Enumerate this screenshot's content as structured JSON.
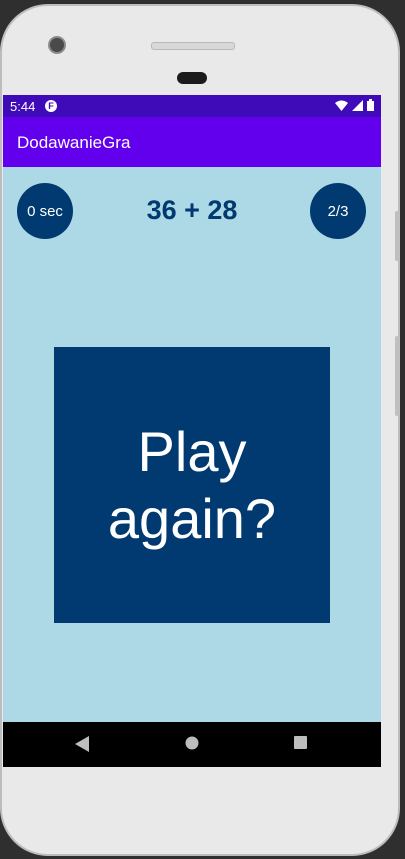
{
  "status_bar": {
    "time": "5:44",
    "notification_icon": "f-icon",
    "icons": [
      "wifi-icon",
      "signal-icon",
      "battery-icon"
    ]
  },
  "app_bar": {
    "title": "DodawanieGra"
  },
  "game": {
    "timer_label": "0 sec",
    "question": "36 + 28",
    "score_label": "2/3",
    "play_again_label": "Play again?"
  },
  "nav_bar": {
    "buttons": [
      "back-icon",
      "home-icon",
      "recents-icon"
    ]
  },
  "colors": {
    "status_bar": "#3f0ab8",
    "app_bar": "#6200ee",
    "background": "#add8e6",
    "accent": "#003a70"
  }
}
